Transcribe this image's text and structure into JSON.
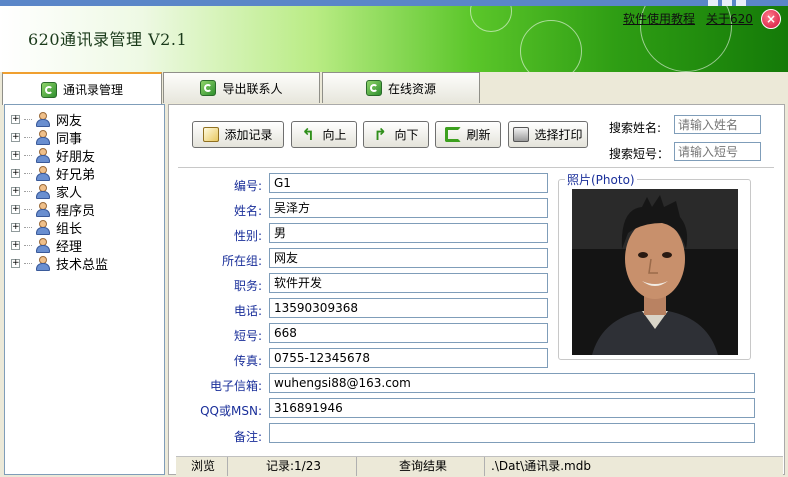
{
  "header": {
    "app_title": "620通讯录管理  V2.1",
    "links": {
      "tutorial": "软件使用教程",
      "about": "关于620"
    },
    "close_symbol": "×"
  },
  "tabs": [
    {
      "label": "通讯录管理",
      "active": true,
      "icon": "refresh-green-icon"
    },
    {
      "label": "导出联系人",
      "active": false,
      "icon": "refresh-green-icon"
    },
    {
      "label": "在线资源",
      "active": false,
      "icon": "refresh-green-icon"
    }
  ],
  "tree": {
    "expander_symbol": "+",
    "groups": [
      "网友",
      "同事",
      "好朋友",
      "好兄弟",
      "家人",
      "程序员",
      "组长",
      "经理",
      "技术总监"
    ]
  },
  "toolbar": {
    "add": "添加记录",
    "prev": "向上",
    "next": "向下",
    "refresh": "刷新",
    "print": "选择打印"
  },
  "search": {
    "name_label": "搜索姓名:",
    "name_placeholder": "请输入姓名",
    "short_label": "搜索短号：",
    "short_placeholder": "请输入短号"
  },
  "form": {
    "id": {
      "label": "编号:",
      "value": "G1"
    },
    "name": {
      "label": "姓名:",
      "value": "吴泽方"
    },
    "gender": {
      "label": "性别:",
      "value": "男"
    },
    "group": {
      "label": "所在组:",
      "value": "网友"
    },
    "position": {
      "label": "职务:",
      "value": "软件开发"
    },
    "phone": {
      "label": "电话:",
      "value": "13590309368"
    },
    "short": {
      "label": "短号:",
      "value": "668"
    },
    "fax": {
      "label": "传真:",
      "value": "0755-12345678"
    },
    "email": {
      "label": "电子信箱:",
      "value": "wuhengsi88@163.com"
    },
    "qq": {
      "label": "QQ或MSN:",
      "value": "316891946"
    },
    "note": {
      "label": "备注:",
      "value": ""
    }
  },
  "photo": {
    "legend": "照片(Photo)"
  },
  "statusbar": {
    "mode": "浏览",
    "record": "记录:1/23",
    "query": "查询结果",
    "path": ".\\Dat\\通讯录.mdb"
  },
  "colors": {
    "label_blue": "#1a2f9a",
    "header_green": "#2f9e14",
    "close_red": "#d0103a"
  }
}
